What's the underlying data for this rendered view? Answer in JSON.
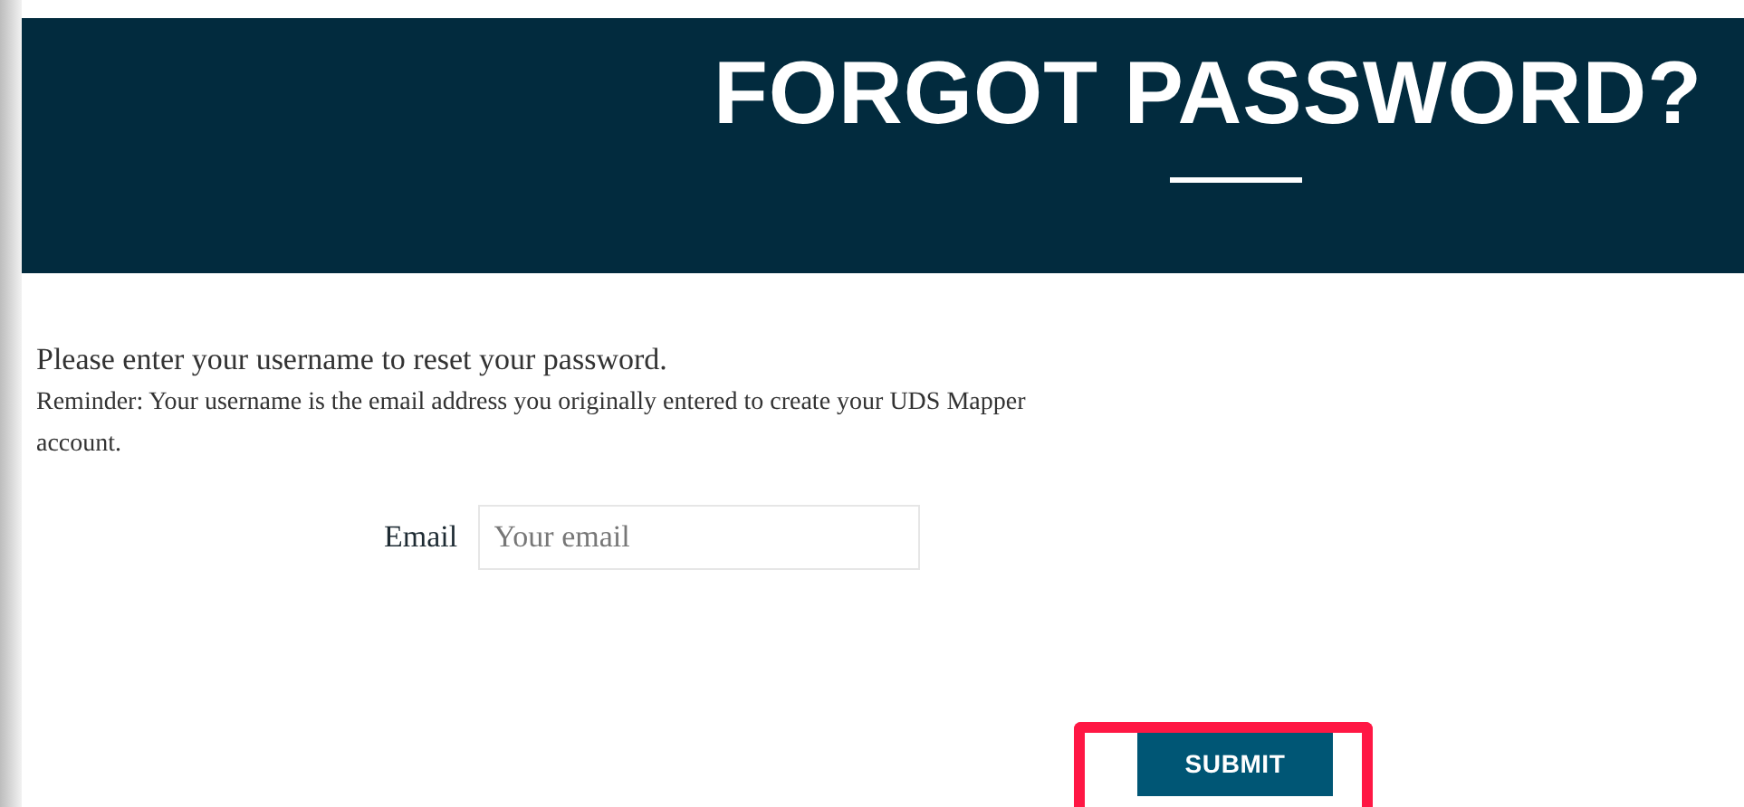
{
  "header": {
    "title": "FORGOT PASSWORD?"
  },
  "intro": "Please enter your username to reset your password.",
  "reminder": "Reminder: Your username is the email address you originally entered to create your UDS Mapper account.",
  "email_field": {
    "label": "Email",
    "placeholder": "Your email"
  },
  "submit_button": {
    "label": "SUBMIT",
    "highlighted": true
  }
}
